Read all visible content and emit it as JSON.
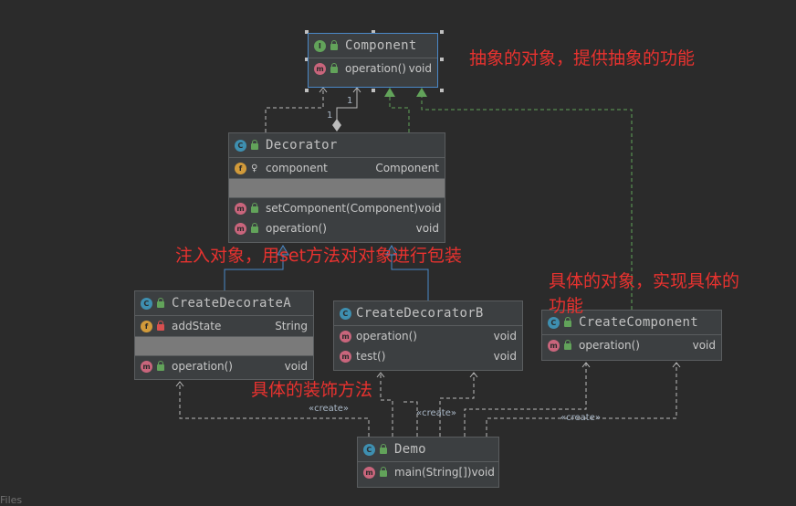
{
  "classes": {
    "component": {
      "name": "Component",
      "badge": "I",
      "methods": [
        {
          "badge": "m",
          "name": "operation()",
          "type": "void"
        }
      ]
    },
    "decorator": {
      "name": "Decorator",
      "badge": "C",
      "fields": [
        {
          "badge": "f",
          "name": "component",
          "type": "Component"
        }
      ],
      "methods": [
        {
          "badge": "m",
          "name": "setComponent(Component)",
          "type": "void"
        },
        {
          "badge": "m",
          "name": "operation()",
          "type": "void"
        }
      ]
    },
    "create_decorate_a": {
      "name": "CreateDecorateA",
      "badge": "C",
      "fields": [
        {
          "badge": "f",
          "name": "addState",
          "type": "String"
        }
      ],
      "methods": [
        {
          "badge": "m",
          "name": "operation()",
          "type": "void"
        }
      ]
    },
    "create_decorator_b": {
      "name": "CreateDecoratorB",
      "badge": "C",
      "methods": [
        {
          "badge": "m",
          "name": "operation()",
          "type": "void"
        },
        {
          "badge": "m",
          "name": "test()",
          "type": "void"
        }
      ]
    },
    "create_component": {
      "name": "CreateComponent",
      "badge": "C",
      "methods": [
        {
          "badge": "m",
          "name": "operation()",
          "type": "void"
        }
      ]
    },
    "demo": {
      "name": "Demo",
      "badge": "C",
      "methods": [
        {
          "badge": "m",
          "name": "main(String[])",
          "type": "void"
        }
      ]
    }
  },
  "notes": {
    "component_note": "抽象的对象，提供抽象的功能",
    "decorator_note": "注入对象，用set方法对对象进行包装",
    "concrete_note_line1": "具体的对象，实现具体的",
    "concrete_note_line2": "功能",
    "decorate_note": "具体的装饰方法"
  },
  "labels": {
    "create_a": "«create»",
    "create_b": "«create»",
    "create_c": "«create»",
    "multiplicity_left": "1",
    "multiplicity_right": "1",
    "files": "Files"
  },
  "colors": {
    "background": "#2b2b2b",
    "node": "#3c3f41",
    "realization": "#62a35a",
    "inheritance": "#4a88c7",
    "dependency": "#bbbbbb",
    "note_text": "#e8322f"
  }
}
